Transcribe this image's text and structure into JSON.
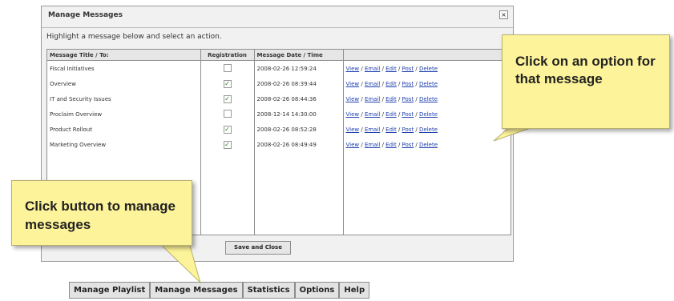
{
  "dialog": {
    "title": "Manage Messages",
    "close": "×",
    "instruction": "Highlight a message below and select an action.",
    "columns": [
      "Message Title / To:",
      "Registration",
      "Message Date / Time",
      ""
    ],
    "rows": [
      {
        "title": "Fiscal Initiatives",
        "registered": false,
        "date": "2008-02-26 12:59:24"
      },
      {
        "title": "Overview",
        "registered": true,
        "date": "2008-02-26 08:39:44"
      },
      {
        "title": "IT and Security Issues",
        "registered": true,
        "date": "2008-02-26 08:44:36"
      },
      {
        "title": "Proclaim Overview",
        "registered": false,
        "date": "2008-12-14 14:30:00"
      },
      {
        "title": "Product Rollout",
        "registered": true,
        "date": "2008-02-26 08:52:28"
      },
      {
        "title": "Marketing Overview",
        "registered": true,
        "date": "2008-02-26 08:49:49"
      }
    ],
    "actions": [
      "View",
      "Email",
      "Edit",
      "Post",
      "Delete"
    ],
    "save_label": "Save and Close"
  },
  "navbar": [
    "Manage Playlist",
    "Manage Messages",
    "Statistics",
    "Options",
    "Help"
  ],
  "callouts": {
    "options": "Click on an option for that message",
    "button": "Click button to manage messages"
  },
  "colors": {
    "callout": "#fdf39a",
    "link": "#1f3fb0",
    "check": "#1d7a1d"
  }
}
